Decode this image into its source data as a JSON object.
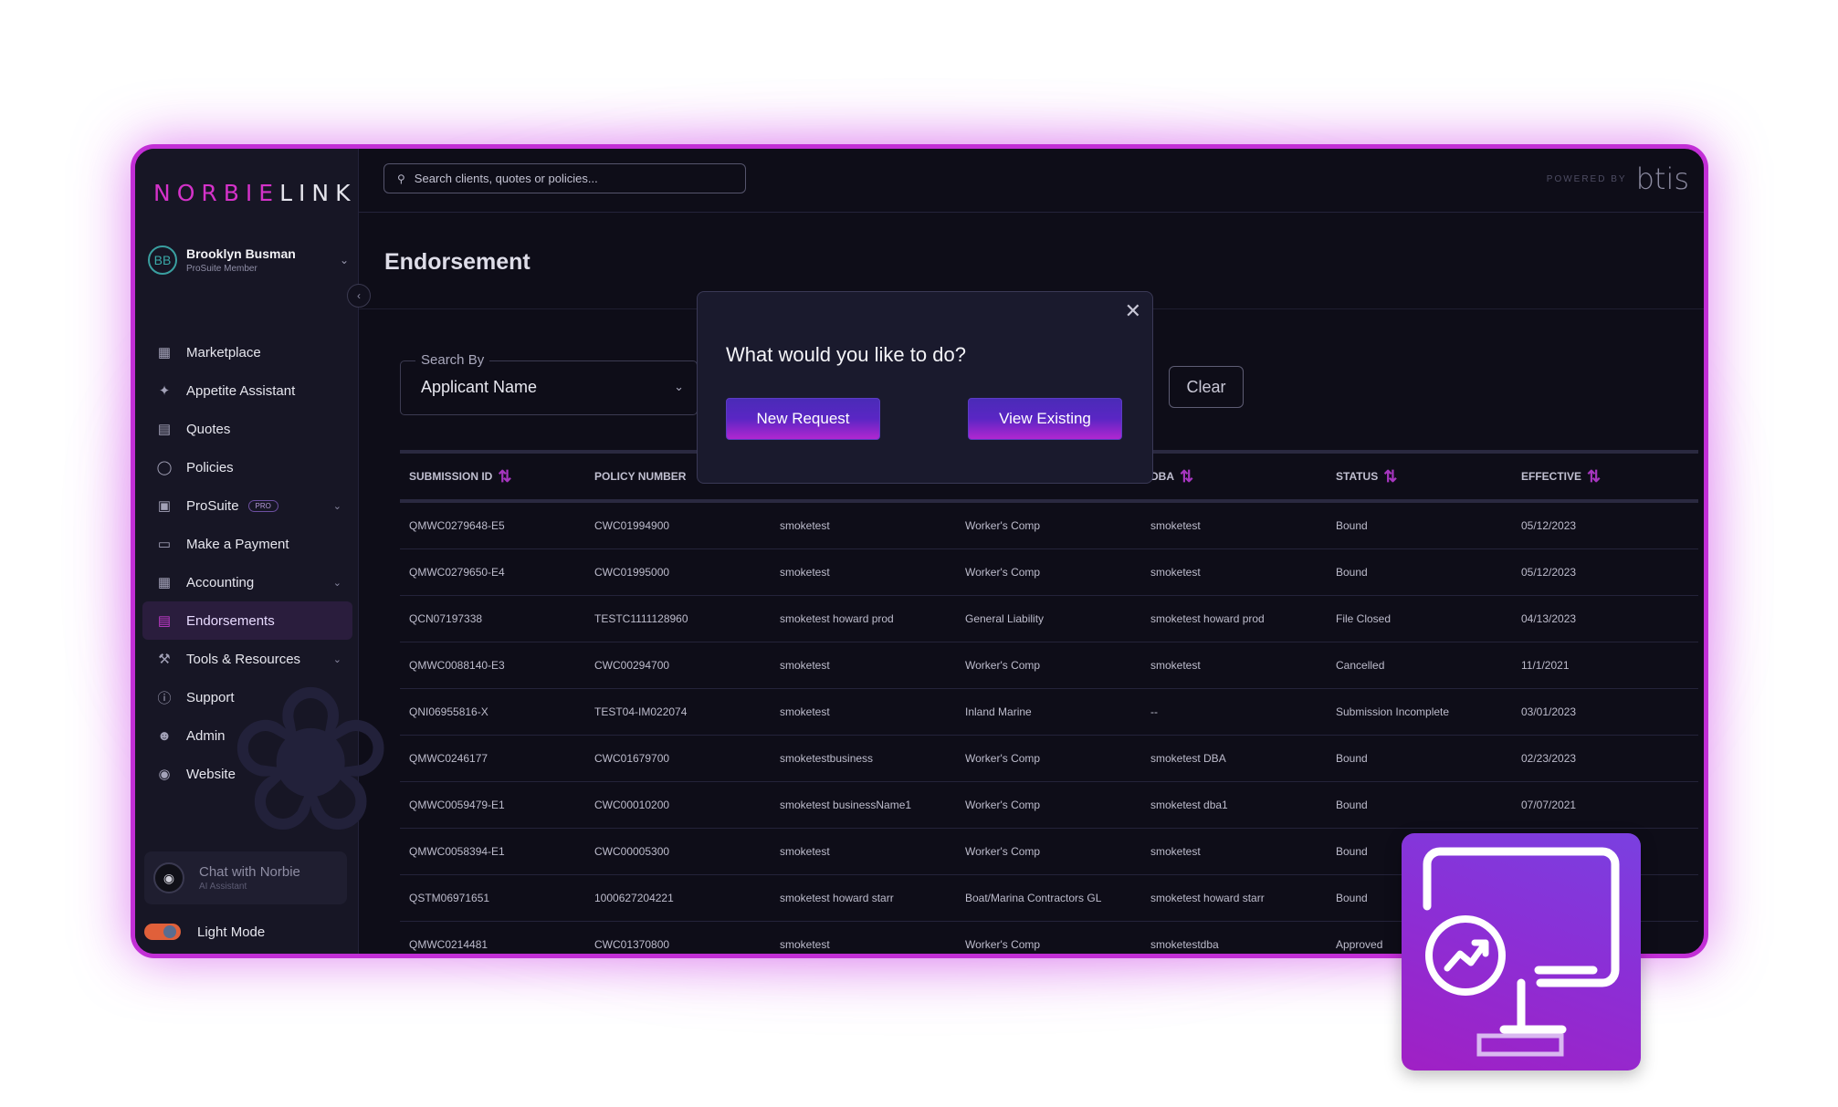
{
  "app": {
    "logo_left": "NORBIE",
    "logo_right": "LINK",
    "powered_by": "POWERED BY",
    "brand": "btis"
  },
  "user": {
    "initials": "BB",
    "name": "Brooklyn Busman",
    "role": "ProSuite Member"
  },
  "search": {
    "placeholder": "Search clients, quotes or policies..."
  },
  "sidebar": {
    "items": [
      {
        "label": "Marketplace",
        "icon": "grid-icon"
      },
      {
        "label": "Appetite Assistant",
        "icon": "sparkle-icon"
      },
      {
        "label": "Quotes",
        "icon": "document-icon"
      },
      {
        "label": "Policies",
        "icon": "shield-icon"
      },
      {
        "label": "ProSuite",
        "icon": "briefcase-icon",
        "badge": "PRO"
      },
      {
        "label": "Make a Payment",
        "icon": "card-icon"
      },
      {
        "label": "Accounting",
        "icon": "calculator-icon"
      },
      {
        "label": "Endorsements",
        "icon": "file-edit-icon"
      },
      {
        "label": "Tools & Resources",
        "icon": "wrench-icon"
      },
      {
        "label": "Support",
        "icon": "help-icon"
      },
      {
        "label": "Admin",
        "icon": "user-gear-icon"
      },
      {
        "label": "Website",
        "icon": "globe-icon"
      }
    ],
    "chat_title": "Chat with Norbie",
    "chat_sub": "AI Assistant",
    "light_mode": "Light Mode"
  },
  "page": {
    "title": "Endorsement",
    "search_by_label": "Search By",
    "search_by_value": "Applicant Name",
    "clear": "Clear"
  },
  "table": {
    "headers": [
      "SUBMISSION ID",
      "POLICY NUMBER",
      "",
      "",
      "DBA",
      "STATUS",
      "EFFECTIVE"
    ],
    "rows": [
      [
        "QMWC0279648-E5",
        "CWC01994900",
        "smoketest",
        "Worker's Comp",
        "smoketest",
        "Bound",
        "05/12/2023"
      ],
      [
        "QMWC0279650-E4",
        "CWC01995000",
        "smoketest",
        "Worker's Comp",
        "smoketest",
        "Bound",
        "05/12/2023"
      ],
      [
        "QCN07197338",
        "TESTC1111128960",
        "smoketest howard prod",
        "General Liability",
        "smoketest howard prod",
        "File Closed",
        "04/13/2023"
      ],
      [
        "QMWC0088140-E3",
        "CWC00294700",
        "smoketest",
        "Worker's Comp",
        "smoketest",
        "Cancelled",
        "11/1/2021"
      ],
      [
        "QNI06955816-X",
        "TEST04-IM022074",
        "smoketest",
        "Inland Marine",
        "--",
        "Submission Incomplete",
        "03/01/2023"
      ],
      [
        "QMWC0246177",
        "CWC01679700",
        "smoketestbusiness",
        "Worker's Comp",
        "smoketest DBA",
        "Bound",
        "02/23/2023"
      ],
      [
        "QMWC0059479-E1",
        "CWC00010200",
        "smoketest businessName1",
        "Worker's Comp",
        "smoketest dba1",
        "Bound",
        "07/07/2021"
      ],
      [
        "QMWC0058394-E1",
        "CWC00005300",
        "smoketest",
        "Worker's Comp",
        "smoketest",
        "Bound",
        ""
      ],
      [
        "QSTM06971651",
        "1000627204221",
        "smoketest howard starr",
        "Boat/Marina Contractors GL",
        "smoketest howard starr",
        "Bound",
        ""
      ],
      [
        "QMWC0214481",
        "CWC01370800",
        "smoketest",
        "Worker's Comp",
        "smoketestdba",
        "Approved",
        ""
      ]
    ]
  },
  "modal": {
    "title": "What would you like to do?",
    "new_request": "New Request",
    "view_existing": "View Existing"
  },
  "colors": {
    "accent": "#c22fd6",
    "background": "#0e0d18",
    "sidebar": "#171625",
    "tile": "#8b2fd6"
  }
}
